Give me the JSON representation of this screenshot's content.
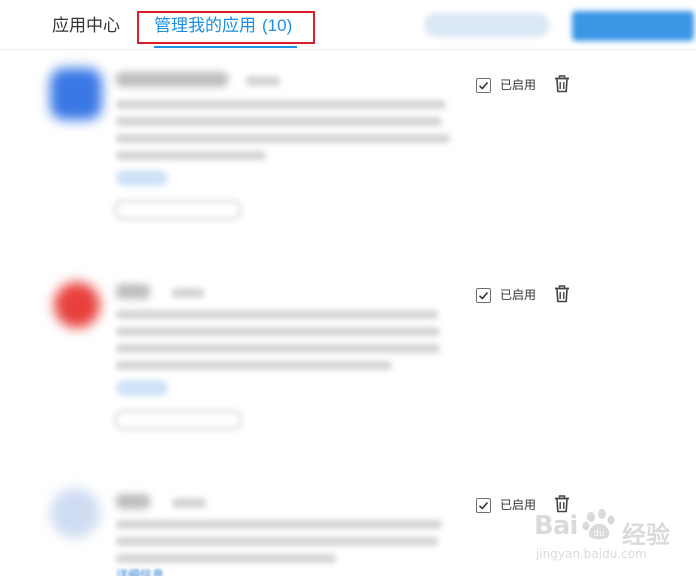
{
  "header": {
    "tab_app_center": "应用中心",
    "tab_manage": "管理我的应用",
    "tab_manage_count": "(10)",
    "accent_color": "#1a8fe3",
    "highlight_color": "#d81e2a"
  },
  "apps": [
    {
      "enabled": true,
      "enabled_label": "已启用",
      "delete_icon": "trash-icon",
      "icon_color": "#3a78e6"
    },
    {
      "enabled": true,
      "enabled_label": "已启用",
      "delete_icon": "trash-icon",
      "icon_color": "#e8413d"
    },
    {
      "enabled": true,
      "enabled_label": "已启用",
      "delete_icon": "trash-icon",
      "icon_color": "#cfdcf2",
      "link_text": "详细信息"
    }
  ],
  "watermark": {
    "brand": "Bai",
    "brand_suffix": "经验",
    "url": "jingyan.baidu.com"
  }
}
